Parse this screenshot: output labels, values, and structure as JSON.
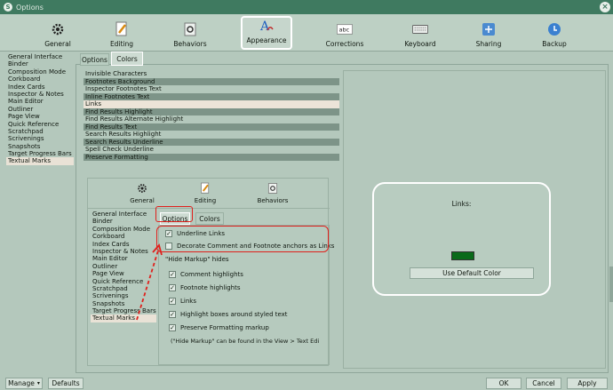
{
  "window": {
    "title": "Options"
  },
  "toolbar": {
    "items": [
      {
        "label": "General",
        "icon": "gear-icon"
      },
      {
        "label": "Editing",
        "icon": "pencil-icon"
      },
      {
        "label": "Behaviors",
        "icon": "gears-icon"
      },
      {
        "label": "Appearance",
        "icon": "appearance-icon",
        "active": true
      },
      {
        "label": "Corrections",
        "icon": "abc-icon"
      },
      {
        "label": "Keyboard",
        "icon": "keyboard-icon"
      },
      {
        "label": "Sharing",
        "icon": "sharing-icon"
      },
      {
        "label": "Backup",
        "icon": "backup-icon"
      }
    ]
  },
  "sidebar": {
    "items": [
      "General Interface",
      "Binder",
      "Composition Mode",
      "Corkboard",
      "Index Cards",
      "Inspector & Notes",
      "Main Editor",
      "Outliner",
      "Page View",
      "Quick Reference",
      "Scratchpad",
      "Scrivenings",
      "Snapshots",
      "Target Progress Bars",
      "Textual Marks"
    ],
    "selected": "Textual Marks"
  },
  "tabs": {
    "options": "Options",
    "colors": "Colors"
  },
  "colors_list": {
    "items": [
      {
        "label": "Invisible Characters",
        "style": "plain"
      },
      {
        "label": "Footnotes Background",
        "style": "dark"
      },
      {
        "label": "Inspector Footnotes Text",
        "style": "plain"
      },
      {
        "label": "Inline Footnotes Text",
        "style": "dark"
      },
      {
        "label": "Links",
        "style": "sel"
      },
      {
        "label": "Find Results Highlight",
        "style": "dark"
      },
      {
        "label": "Find Results Alternate Highlight",
        "style": "plain"
      },
      {
        "label": "Find Results Text",
        "style": "dark"
      },
      {
        "label": "Search Results Highlight",
        "style": "plain"
      },
      {
        "label": "Search Results Underline",
        "style": "dark"
      },
      {
        "label": "Spell Check Underline",
        "style": "plain"
      },
      {
        "label": "Preserve Formatting",
        "style": "dark"
      }
    ]
  },
  "inner": {
    "toolbar": [
      "General",
      "Editing",
      "Behaviors"
    ],
    "sidebar": [
      "General Interface",
      "Binder",
      "Composition Mode",
      "Corkboard",
      "Index Cards",
      "Inspector & Notes",
      "Main Editor",
      "Outliner",
      "Page View",
      "Quick Reference",
      "Scratchpad",
      "Scrivenings",
      "Snapshots",
      "Target Progress Bars",
      "Textual Marks"
    ],
    "tabs": {
      "options": "Options",
      "colors": "Colors"
    },
    "underline_links": "Underline Links",
    "decorate_anchors": "Decorate Comment and Footnote anchors as Links",
    "hide_markup_heading": "\"Hide Markup\" hides",
    "hide_items": [
      "Comment highlights",
      "Footnote highlights",
      "Links",
      "Highlight boxes around styled text",
      "Preserve Formatting markup"
    ],
    "hide_note": "(\"Hide Markup\" can be found in the View > Text Edi"
  },
  "preview": {
    "label": "Links:",
    "swatch_color": "#0a6a1a",
    "default_button": "Use Default Color"
  },
  "footer": {
    "manage": "Manage",
    "defaults": "Defaults",
    "ok": "OK",
    "cancel": "Cancel",
    "apply": "Apply"
  },
  "colors": {
    "annotation_red": "#e0201c",
    "titlebar": "#3f7a60"
  }
}
